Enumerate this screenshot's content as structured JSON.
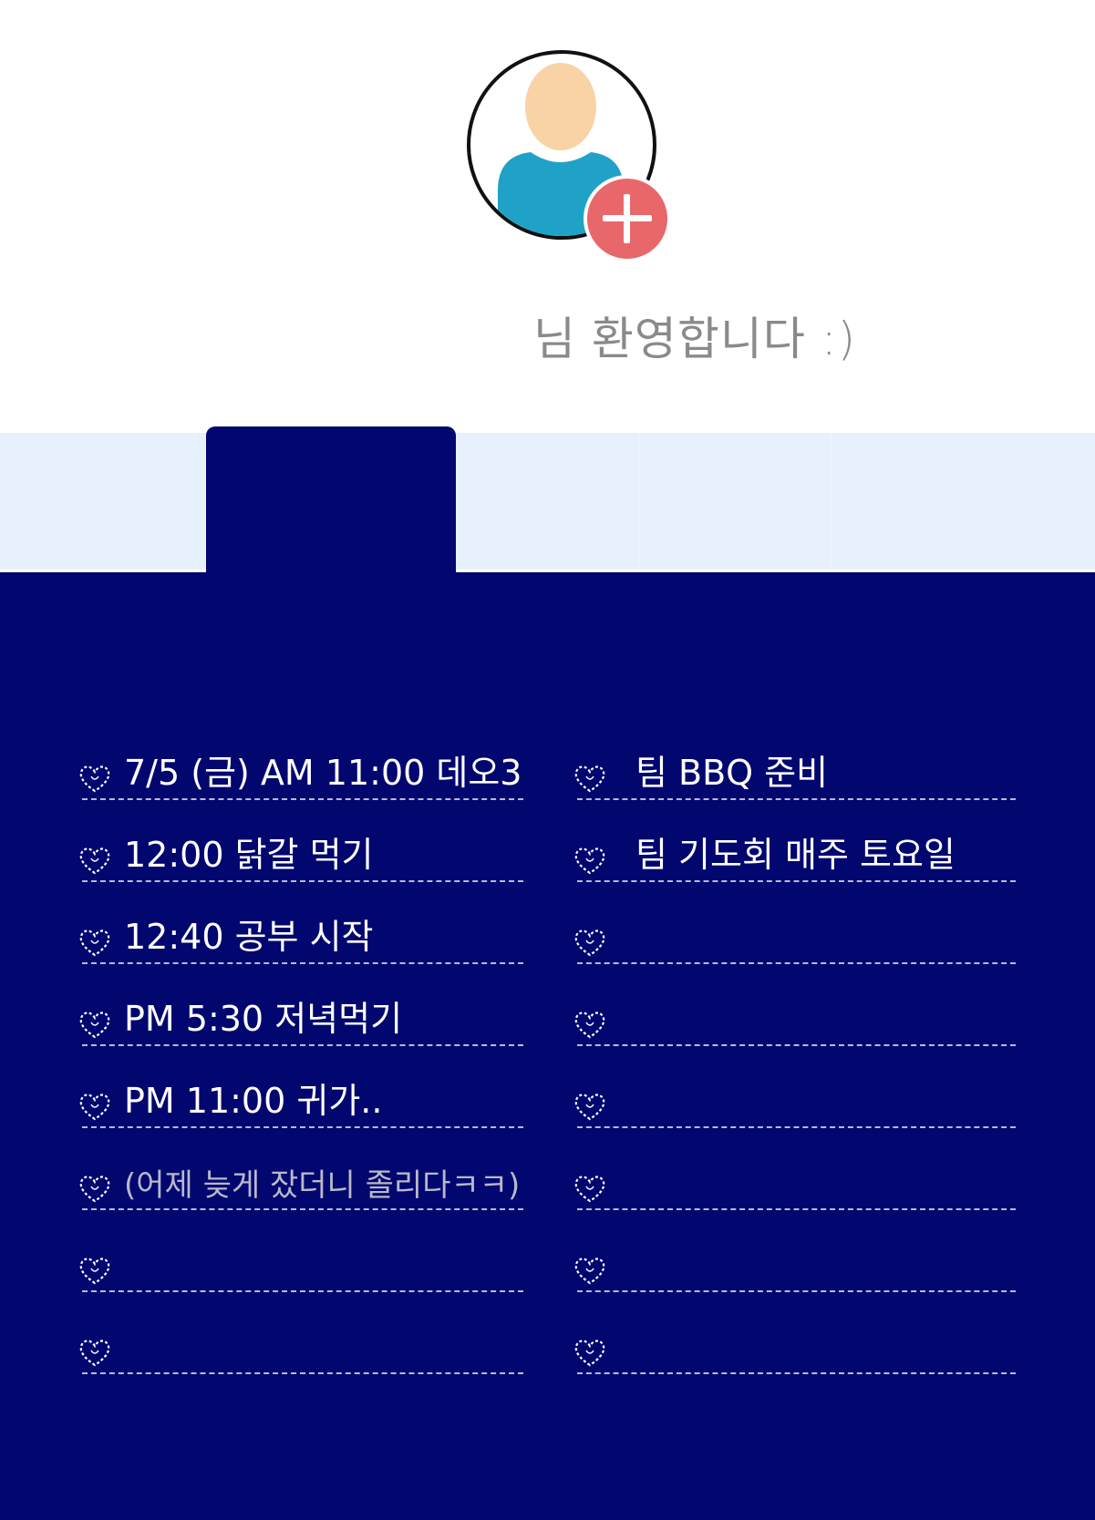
{
  "profile": {
    "welcome_text": "님 환영합니다 :)",
    "avatar_icon": "user-avatar-icon",
    "add_icon": "plus-icon",
    "add_color": "#e8676a"
  },
  "panel": {
    "background": "#02066f",
    "left_items": [
      {
        "text": "7/5 (금) AM 11:00 데오3"
      },
      {
        "text": "12:00  닭갈 먹기"
      },
      {
        "text": "12:40  공부 시작"
      },
      {
        "text": "PM 5:30  저녁먹기"
      },
      {
        "text": "PM 11:00  귀가.."
      },
      {
        "text": "(어제 늦게 잤더니 졸리다ㅋㅋ)"
      },
      {
        "text": ""
      },
      {
        "text": ""
      }
    ],
    "right_items": [
      {
        "text": "팀 BBQ 준비"
      },
      {
        "text": "팀 기도회 매주 토요일"
      },
      {
        "text": ""
      },
      {
        "text": ""
      },
      {
        "text": ""
      },
      {
        "text": ""
      },
      {
        "text": ""
      },
      {
        "text": ""
      }
    ]
  }
}
